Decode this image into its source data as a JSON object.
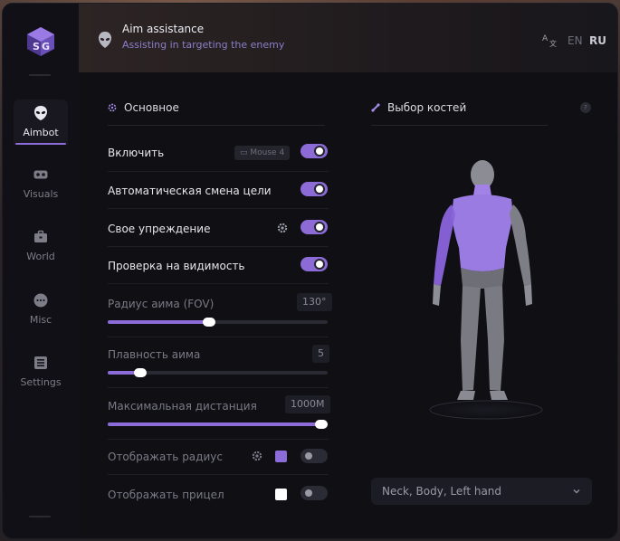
{
  "app": {
    "title": "Aim assistance",
    "subtitle": "Assisting in targeting the enemy",
    "languages": [
      "EN",
      "RU"
    ],
    "active_language": "RU",
    "accent_color": "#8b6cd9"
  },
  "sidebar": {
    "items": [
      {
        "label": "Aimbot",
        "icon": "alien-head-icon",
        "active": true
      },
      {
        "label": "Visuals",
        "icon": "vr-goggles-icon",
        "active": false
      },
      {
        "label": "World",
        "icon": "briefcase-icon",
        "active": false
      },
      {
        "label": "Misc",
        "icon": "chat-dots-icon",
        "active": false
      },
      {
        "label": "Settings",
        "icon": "list-settings-icon",
        "active": false
      }
    ]
  },
  "main": {
    "section_title": "Основное",
    "enable": {
      "label": "Включить",
      "keybind": "Mouse 4",
      "on": true
    },
    "auto_switch": {
      "label": "Автоматическая смена цели",
      "on": true
    },
    "prediction": {
      "label": "Свое упреждение",
      "on": true
    },
    "visibility_check": {
      "label": "Проверка на видимость",
      "on": true
    },
    "fov": {
      "label": "Радиус аима (FOV)",
      "value": "130°",
      "fraction": 0.46
    },
    "smooth": {
      "label": "Плавность аима",
      "value": "5",
      "fraction": 0.15
    },
    "max_distance": {
      "label": "Максимальная дистанция",
      "value": "1000M",
      "fraction": 1.0
    },
    "show_radius": {
      "label": "Отображать радиус",
      "color": "#8b6cd9",
      "on": false
    },
    "show_crosshair": {
      "label": "Отображать прицел",
      "color": "#ffffff",
      "on": false
    }
  },
  "bones": {
    "section_title": "Выбор костей",
    "help_badge": "?",
    "selected_value": "Neck, Body, Left hand"
  }
}
